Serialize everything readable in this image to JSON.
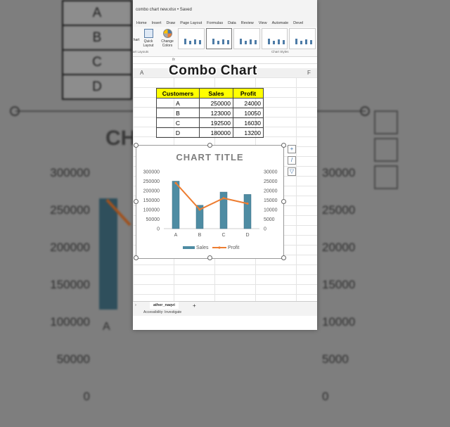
{
  "background": {
    "table_rows": [
      "A",
      "B",
      "C",
      "D"
    ],
    "y_left_ticks": [
      "300000",
      "250000",
      "200000",
      "150000",
      "100000",
      "50000",
      "0"
    ],
    "y_right_ticks": [
      "30000",
      "25000",
      "20000",
      "15000",
      "10000",
      "5000",
      "0"
    ],
    "title_fragment": "CH",
    "x_label": "A"
  },
  "window": {
    "title": "combo chart new.xlsx • Saved",
    "tabs": [
      "Home",
      "Insert",
      "Draw",
      "Page Layout",
      "Formulas",
      "Data",
      "Review",
      "View",
      "Automate",
      "Devel"
    ],
    "ribbon": {
      "add_chart_label": "hart",
      "quick_layout_label": "Quick Layout",
      "change_colors_label": "Change Colors",
      "group_layouts": "art Layouts",
      "group_styles": "Chart Styles"
    },
    "formula_bar": "fx",
    "columns": [
      "A",
      "F"
    ],
    "sheet_tab": "ather_naqvi",
    "add_sheet": "+",
    "status": "Accessibility: Investigate"
  },
  "overlay_title": "Combo Chart",
  "table": {
    "headers": [
      "Customers",
      "Sales",
      "Profit"
    ],
    "rows": [
      {
        "customer": "A",
        "sales": "250000",
        "profit": "24000"
      },
      {
        "customer": "B",
        "sales": "123000",
        "profit": "10050"
      },
      {
        "customer": "C",
        "sales": "192500",
        "profit": "16030"
      },
      {
        "customer": "D",
        "sales": "180000",
        "profit": "13200"
      }
    ]
  },
  "chart_data": {
    "type": "bar",
    "title": "CHART TITLE",
    "categories": [
      "A",
      "B",
      "C",
      "D"
    ],
    "series": [
      {
        "name": "Sales",
        "type": "bar",
        "axis": "left",
        "values": [
          250000,
          123000,
          192500,
          180000
        ],
        "color": "#4e8ca3"
      },
      {
        "name": "Profit",
        "type": "line",
        "axis": "right",
        "values": [
          24000,
          10050,
          16030,
          13200
        ],
        "color": "#ed7d31"
      }
    ],
    "y_left": {
      "min": 0,
      "max": 300000,
      "ticks": [
        0,
        50000,
        100000,
        150000,
        200000,
        250000,
        300000
      ]
    },
    "y_right": {
      "min": 0,
      "max": 30000,
      "ticks": [
        0,
        5000,
        10000,
        15000,
        20000,
        25000,
        30000
      ]
    },
    "legend_position": "bottom",
    "grid": false
  }
}
